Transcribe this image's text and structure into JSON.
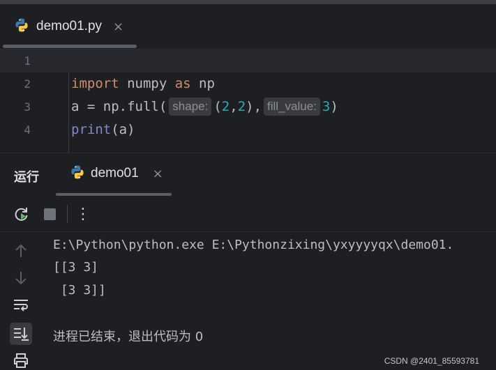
{
  "editor": {
    "tab": {
      "label": "demo01.py",
      "close": "×"
    },
    "lines": [
      {
        "num": "1"
      },
      {
        "num": "2",
        "kw1": "import",
        "t1": " numpy ",
        "kw2": "as",
        "t2": " np"
      },
      {
        "num": "3",
        "t1": "a = np.full(",
        "hint_shape": "shape:",
        "t2": "(",
        "n1": "2",
        "comma": ",",
        "n2": "2",
        "t3": "),",
        "hint_fill": "fill_value:",
        "n3": "3",
        "t4": ")"
      },
      {
        "num": "4",
        "bi": "print",
        "t1": "(a)"
      }
    ]
  },
  "run": {
    "title": "运行",
    "tab": {
      "label": "demo01",
      "close": "×"
    },
    "toolbar": {
      "more": "⋮"
    },
    "console": [
      "E:\\Python\\python.exe E:\\Pythonzixing\\yxyyyyqx\\demo01.",
      "[[3 3]",
      " [3 3]]",
      "",
      "进程已结束，退出代码为 0"
    ]
  },
  "watermark": "CSDN @2401_85593781",
  "colors": {
    "keyword": "#cf8e6d",
    "number": "#2aacb8",
    "builtin": "#8888c6",
    "background": "#1e1f22"
  }
}
